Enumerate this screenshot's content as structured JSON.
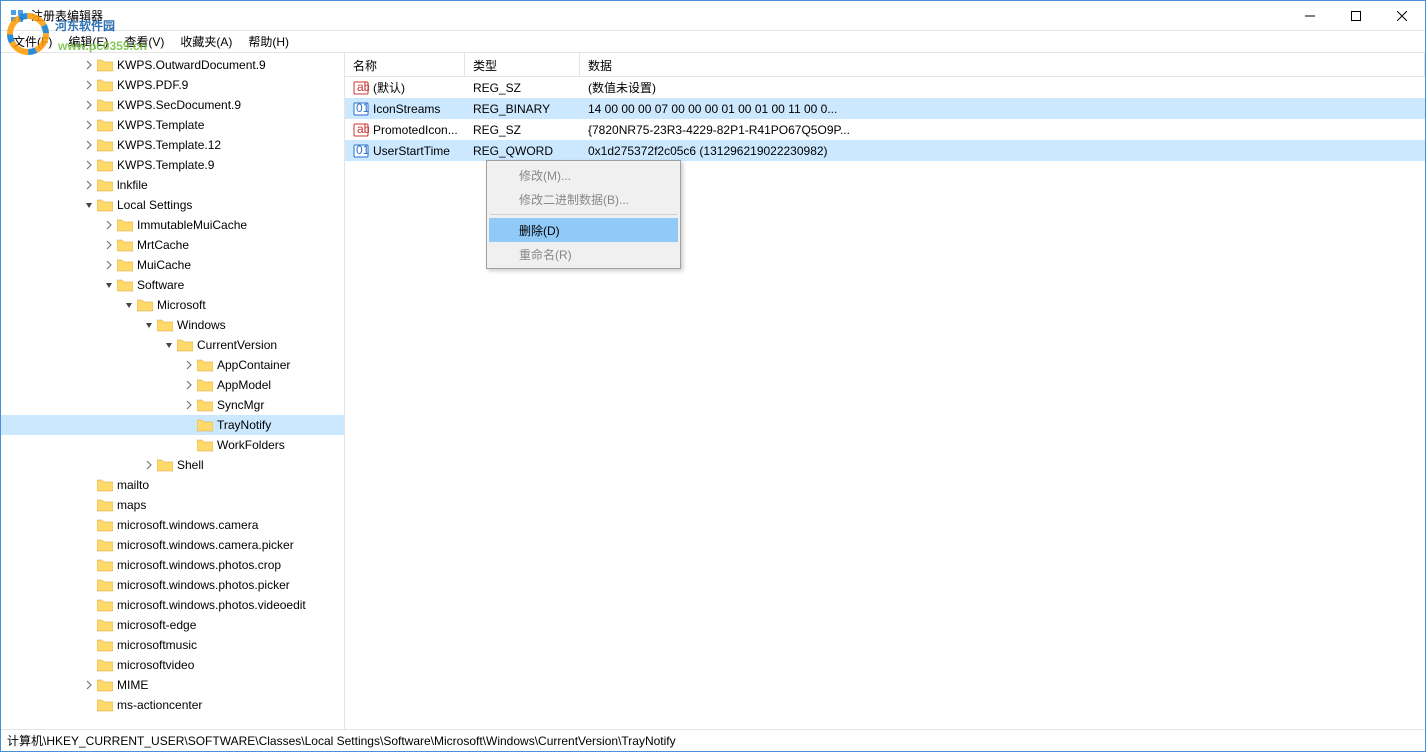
{
  "window": {
    "title": "注册表编辑器"
  },
  "menubar": [
    "文件(F)",
    "编辑(E)",
    "查看(V)",
    "收藏夹(A)",
    "帮助(H)"
  ],
  "tree": [
    {
      "indent": 80,
      "caret": "closed",
      "label": "KWPS.OutwardDocument.9"
    },
    {
      "indent": 80,
      "caret": "closed",
      "label": "KWPS.PDF.9"
    },
    {
      "indent": 80,
      "caret": "closed",
      "label": "KWPS.SecDocument.9"
    },
    {
      "indent": 80,
      "caret": "closed",
      "label": "KWPS.Template"
    },
    {
      "indent": 80,
      "caret": "closed",
      "label": "KWPS.Template.12"
    },
    {
      "indent": 80,
      "caret": "closed",
      "label": "KWPS.Template.9"
    },
    {
      "indent": 80,
      "caret": "closed",
      "label": "lnkfile"
    },
    {
      "indent": 80,
      "caret": "open",
      "label": "Local Settings"
    },
    {
      "indent": 100,
      "caret": "closed",
      "label": "ImmutableMuiCache"
    },
    {
      "indent": 100,
      "caret": "closed",
      "label": "MrtCache"
    },
    {
      "indent": 100,
      "caret": "closed",
      "label": "MuiCache"
    },
    {
      "indent": 100,
      "caret": "open",
      "label": "Software"
    },
    {
      "indent": 120,
      "caret": "open",
      "label": "Microsoft"
    },
    {
      "indent": 140,
      "caret": "open",
      "label": "Windows"
    },
    {
      "indent": 160,
      "caret": "open",
      "label": "CurrentVersion"
    },
    {
      "indent": 180,
      "caret": "closed",
      "label": "AppContainer"
    },
    {
      "indent": 180,
      "caret": "closed",
      "label": "AppModel"
    },
    {
      "indent": 180,
      "caret": "closed",
      "label": "SyncMgr"
    },
    {
      "indent": 180,
      "caret": "none",
      "label": "TrayNotify",
      "selected": true
    },
    {
      "indent": 180,
      "caret": "none",
      "label": "WorkFolders"
    },
    {
      "indent": 140,
      "caret": "closed",
      "label": "Shell"
    },
    {
      "indent": 80,
      "caret": "none",
      "label": "mailto"
    },
    {
      "indent": 80,
      "caret": "none",
      "label": "maps"
    },
    {
      "indent": 80,
      "caret": "none",
      "label": "microsoft.windows.camera"
    },
    {
      "indent": 80,
      "caret": "none",
      "label": "microsoft.windows.camera.picker"
    },
    {
      "indent": 80,
      "caret": "none",
      "label": "microsoft.windows.photos.crop"
    },
    {
      "indent": 80,
      "caret": "none",
      "label": "microsoft.windows.photos.picker"
    },
    {
      "indent": 80,
      "caret": "none",
      "label": "microsoft.windows.photos.videoedit"
    },
    {
      "indent": 80,
      "caret": "none",
      "label": "microsoft-edge"
    },
    {
      "indent": 80,
      "caret": "none",
      "label": "microsoftmusic"
    },
    {
      "indent": 80,
      "caret": "none",
      "label": "microsoftvideo"
    },
    {
      "indent": 80,
      "caret": "closed",
      "label": "MIME"
    },
    {
      "indent": 80,
      "caret": "none",
      "label": "ms-actioncenter"
    }
  ],
  "list": {
    "columns": {
      "name": "名称",
      "type": "类型",
      "data": "数据"
    },
    "rows": [
      {
        "icon": "string",
        "name": "(默认)",
        "type": "REG_SZ",
        "data": "(数值未设置)"
      },
      {
        "icon": "binary",
        "name": "IconStreams",
        "type": "REG_BINARY",
        "data": "14 00 00 00 07 00 00 00 01 00 01 00 11 00 0...",
        "selected": true
      },
      {
        "icon": "string",
        "name": "PromotedIcon...",
        "type": "REG_SZ",
        "data": "{7820NR75-23R3-4229-82P1-R41PO67Q5O9P..."
      },
      {
        "icon": "binary",
        "name": "UserStartTime",
        "type": "REG_QWORD",
        "data": "0x1d275372f2c05c6 (131296219022230982)",
        "selected": true
      }
    ]
  },
  "context_menu": {
    "items": [
      {
        "label": "修改(M)...",
        "disabled": true
      },
      {
        "label": "修改二进制数据(B)...",
        "disabled": true
      },
      {
        "sep": true
      },
      {
        "label": "删除(D)",
        "highlighted": true
      },
      {
        "label": "重命名(R)",
        "disabled": true
      }
    ]
  },
  "statusbar": "计算机\\HKEY_CURRENT_USER\\SOFTWARE\\Classes\\Local Settings\\Software\\Microsoft\\Windows\\CurrentVersion\\TrayNotify",
  "watermark": {
    "line1": "河东软件园",
    "line2": "www.pc0359.cn"
  }
}
